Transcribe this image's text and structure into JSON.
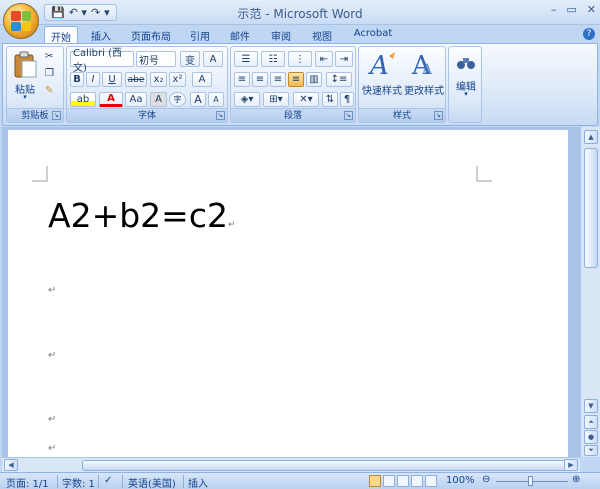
{
  "window": {
    "title": "示范 - Microsoft Word",
    "controls": [
      "–",
      "▭",
      "✕"
    ]
  },
  "qat": {
    "save": "💾",
    "undo": "↶ ▾",
    "redo": "↷",
    "customize": "▾"
  },
  "tabs": [
    "开始",
    "插入",
    "页面布局",
    "引用",
    "邮件",
    "审阅",
    "视图",
    "Acrobat"
  ],
  "help": "?",
  "ribbon": {
    "clipboard": {
      "label": "剪贴板",
      "paste": "粘贴",
      "paste_arrow": "▾"
    },
    "font": {
      "label": "字体",
      "font_name": "Calibri (西文)",
      "font_size": "初号",
      "bold": "B",
      "italic": "I",
      "underline": "U",
      "strike": "abe",
      "subscript": "x₂",
      "superscript": "x²",
      "clear": "A",
      "highlight": "ab",
      "font_color": "A",
      "case": "Aa",
      "char_border": "A",
      "enclose": "字",
      "grow": "A",
      "shrink": "A",
      "phonetic": "变",
      "font_border": "A"
    },
    "paragraph": {
      "label": "段落"
    },
    "styles": {
      "label": "样式",
      "quick": "快速样式",
      "change": "更改样式"
    },
    "editing": {
      "label": "编辑"
    }
  },
  "document": {
    "text": "A2+b2=c2",
    "para_mark": "↵"
  },
  "status": {
    "page": "页面: 1/1",
    "words": "字数: 1",
    "language": "英语(美国)",
    "mode": "插入",
    "zoom": "100%",
    "zoom_minus": "⊖",
    "zoom_plus": "⊕"
  },
  "colors": {
    "accent": "#15428b",
    "ribbon_bg": "#dce8f8",
    "highlight": "#ffff00",
    "font_color": "#e00000"
  }
}
